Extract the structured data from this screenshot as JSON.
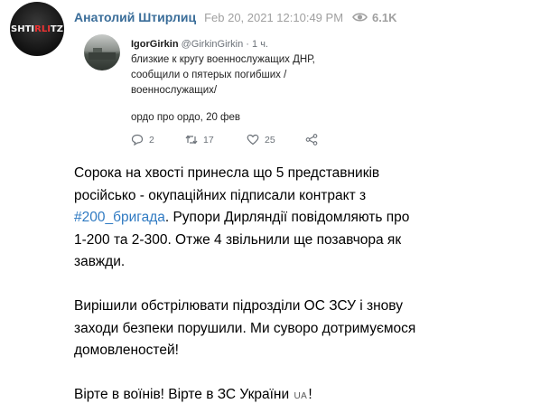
{
  "header": {
    "avatar_text_a": "SHTI",
    "avatar_text_b": "RLI",
    "avatar_text_c": "TZ",
    "channel_name": "Анатолий Штирлиц",
    "timestamp": "Feb 20, 2021 12:10:49 PM",
    "views": "6.1K",
    "views_icon": "eye-icon"
  },
  "tweet": {
    "author": "IgorGirkin",
    "handle": "@GirkinGirkin · 1 ч.",
    "lines": [
      "близкие к кругу военнослужащих ДНР,",
      "сообщили о пятерых погибших /",
      "военнослужащих/"
    ],
    "signature": "ордо про ордо, 20 фев",
    "replies": "2",
    "retweets": "17",
    "likes": "25",
    "icons": [
      "reply-icon",
      "retweet-icon",
      "like-icon",
      "share-icon"
    ]
  },
  "post": {
    "line1": "Сорока на хвості принесла що 5 представників",
    "line2": "російсько - окупаційних підписали контракт з",
    "hashtag": "#200_бригада",
    "line3_rest": ". Рупори Дирляндії повідомляють про",
    "line4": "1-200 та 2-300. Отже 4 звільнили ще позавчора як",
    "line5": "завжди.",
    "line6": "Вирішили обстрілювати підрозділи ОС ЗСУ і знову",
    "line7": "заходи безпеки порушили. Ми суворо дотримуємося",
    "line8": "домовленостей!",
    "line9_a": "Вірте в воїнів! Вірте в ЗС України ",
    "flag": "UA",
    "line9_b": "!"
  }
}
